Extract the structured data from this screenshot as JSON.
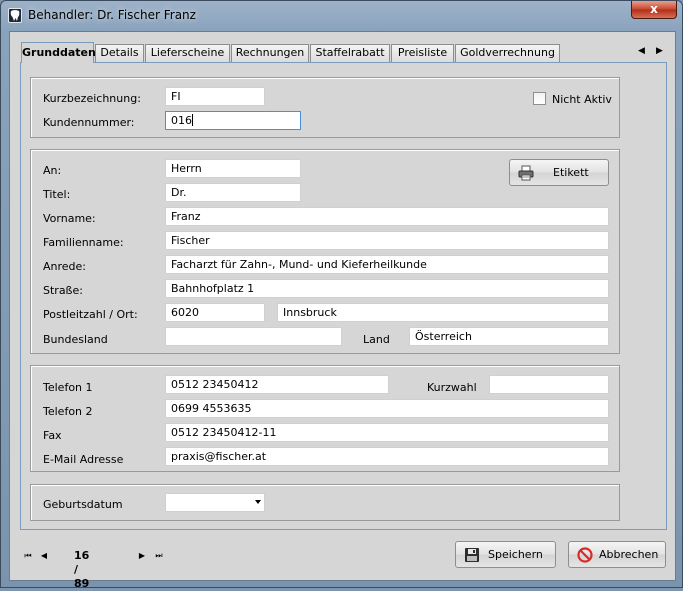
{
  "window": {
    "title": "Behandler: Dr. Fischer Franz",
    "close_glyph": "x"
  },
  "tabs": [
    {
      "label": "Grunddaten",
      "active": true
    },
    {
      "label": "Details",
      "active": false
    },
    {
      "label": "Lieferscheine",
      "active": false
    },
    {
      "label": "Rechnungen",
      "active": false
    },
    {
      "label": "Staffelrabatt",
      "active": false
    },
    {
      "label": "Preisliste",
      "active": false
    },
    {
      "label": "Goldverrechnung",
      "active": false
    }
  ],
  "tab_scroll": {
    "left": "◀",
    "right": "▶"
  },
  "header_group": {
    "kurzbezeichnung_label": "Kurzbezeichnung:",
    "kurzbezeichnung_value": "FI",
    "kundennummer_label": "Kundennummer:",
    "kundennummer_value": "016",
    "nicht_aktiv_label": "Nicht Aktiv",
    "nicht_aktiv_checked": false
  },
  "address_group": {
    "an_label": "An:",
    "an_value": "Herrn",
    "titel_label": "Titel:",
    "titel_value": "Dr.",
    "vorname_label": "Vorname:",
    "vorname_value": "Franz",
    "familienname_label": "Familienname:",
    "familienname_value": "Fischer",
    "anrede_label": "Anrede:",
    "anrede_value": "Facharzt für Zahn-, Mund- und Kieferheilkunde",
    "strasse_label": "Straße:",
    "strasse_value": "Bahnhofplatz 1",
    "plz_ort_label": "Postleitzahl / Ort:",
    "plz_value": "6020",
    "ort_value": "Innsbruck",
    "bundesland_label": "Bundesland",
    "bundesland_value": "",
    "land_label": "Land",
    "land_value": "Österreich",
    "etikett_label": "Etikett"
  },
  "contact_group": {
    "telefon1_label": "Telefon 1",
    "telefon1_value": "0512 23450412",
    "kurzwahl_label": "Kurzwahl",
    "kurzwahl_value": "",
    "telefon2_label": "Telefon 2",
    "telefon2_value": "0699 4553635",
    "fax_label": "Fax",
    "fax_value": "0512 23450412-11",
    "email_label": "E-Mail Adresse",
    "email_value": "praxis@fischer.at"
  },
  "birth_group": {
    "geburtsdatum_label": "Geburtsdatum",
    "geburtsdatum_value": ""
  },
  "navigation": {
    "first": "⏮",
    "prev": "◀",
    "next": "▶",
    "last": "⏭",
    "counter": "16 / 89"
  },
  "buttons": {
    "save_label": "Speichern",
    "cancel_label": "Abbrechen"
  },
  "colors": {
    "panel_border": "#7a9cbf",
    "cancel_icon": "#d62b2b"
  }
}
